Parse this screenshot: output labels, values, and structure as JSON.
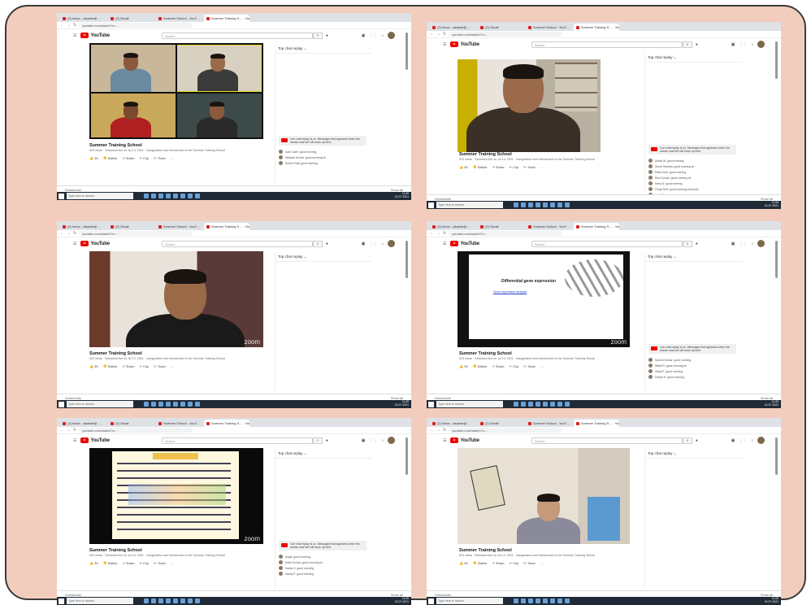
{
  "browser": {
    "tabs": [
      "(2) Inbox - akashe@…",
      "(2) Gmail",
      "Summer School - YouT…",
      "Summer Training S… - YouTube"
    ],
    "url": "youtube.com/watch?v=…"
  },
  "youtube": {
    "logo": "YouTube",
    "search_placeholder": "Search",
    "search_icon": "search-icon",
    "mic_icon": "mic-icon"
  },
  "panels": [
    {
      "title": "Summer Training School",
      "meta": "523 views · Streamed live on Jul 13, 2021 · Inauguration and Introduction to the Summer Training School",
      "chat_header": "Top chat replay ⌄",
      "pinned": "Live chat replay is on. Messages that appeared when the stream was live will show up here.",
      "messages": [
        "Aarti Joshi: good morning",
        "Mahesh Kumar: good morning sir",
        "Sneha Patil: good morning"
      ]
    },
    {
      "title": "Summer Training School",
      "meta": "523 views · Streamed live on Jul 13, 2021 · Inauguration and Introduction to the Summer Training School",
      "chat_header": "Top chat replay ⌄",
      "pinned": "Live chat replay is on. Messages that appeared when the stream was live will show up here.",
      "messages": [
        "Akash M: good evening",
        "Shruti Sharma: good evening sir",
        "Rahul Das: good evening",
        "Ravi Kumar: good evening sir",
        "Neha S: good evening",
        "Pooja Devi: good evening everyone",
        "Ankit Raj: good evening",
        "Meera P: good evening sir"
      ]
    },
    {
      "title": "Summer Training School",
      "meta": "523 views · Streamed live on Jul 13, 2021 · Inauguration and Introduction to the Summer Training School",
      "chat_header": "Top chat replay ⌄",
      "pinned": "",
      "messages": []
    },
    {
      "title": "Summer Training School",
      "meta": "523 views · Streamed live on Jul 13, 2021 · Inauguration and Introduction to the Summer Training School",
      "chat_header": "Top chat replay ⌄",
      "pinned": "Live chat replay is on. Messages that appeared when the stream was live will show up here.",
      "messages": [
        "Suresh Kumar: good morning",
        "Nikita R: good morning sir",
        "Vikas P: good morning",
        "Deepa K: good morning"
      ],
      "slide_title": "Differential gene expression",
      "slide_subtitle": "Gene expression analysis"
    },
    {
      "title": "Summer Training School",
      "meta": "523 views · Streamed live on Jul 13, 2021 · Inauguration and Introduction to the Summer Training School",
      "chat_header": "Top chat replay ⌄",
      "pinned": "Live chat replay is on. Messages that appeared when the stream was live will show up here.",
      "messages": [
        "Anjali: good morning",
        "Rohit Kumar: good morning sir",
        "Kavita S: good morning",
        "Manoj P: good morning"
      ]
    },
    {
      "title": "Summer Training School",
      "meta": "523 views · Streamed live on Jul 13, 2021 · Inauguration and Introduction to the Summer Training School",
      "chat_header": "Top chat replay ⌄",
      "pinned": "",
      "messages": []
    }
  ],
  "actions": {
    "like": "👍 35",
    "dislike": "👎 Dislike",
    "share": "↗ Share",
    "clip": "✂ Clip",
    "save": "≡+ Save",
    "more": "…"
  },
  "downloads": {
    "left": "Downloads",
    "right": "Show all"
  },
  "taskbar": {
    "search": "Type here to search",
    "time": "11:05",
    "date": "13-07-2021"
  },
  "zoom_watermark": "zoom",
  "colors": {
    "frame": "#f2cdbd",
    "youtube_red": "#e00000",
    "taskbar": "#1f2a36"
  }
}
